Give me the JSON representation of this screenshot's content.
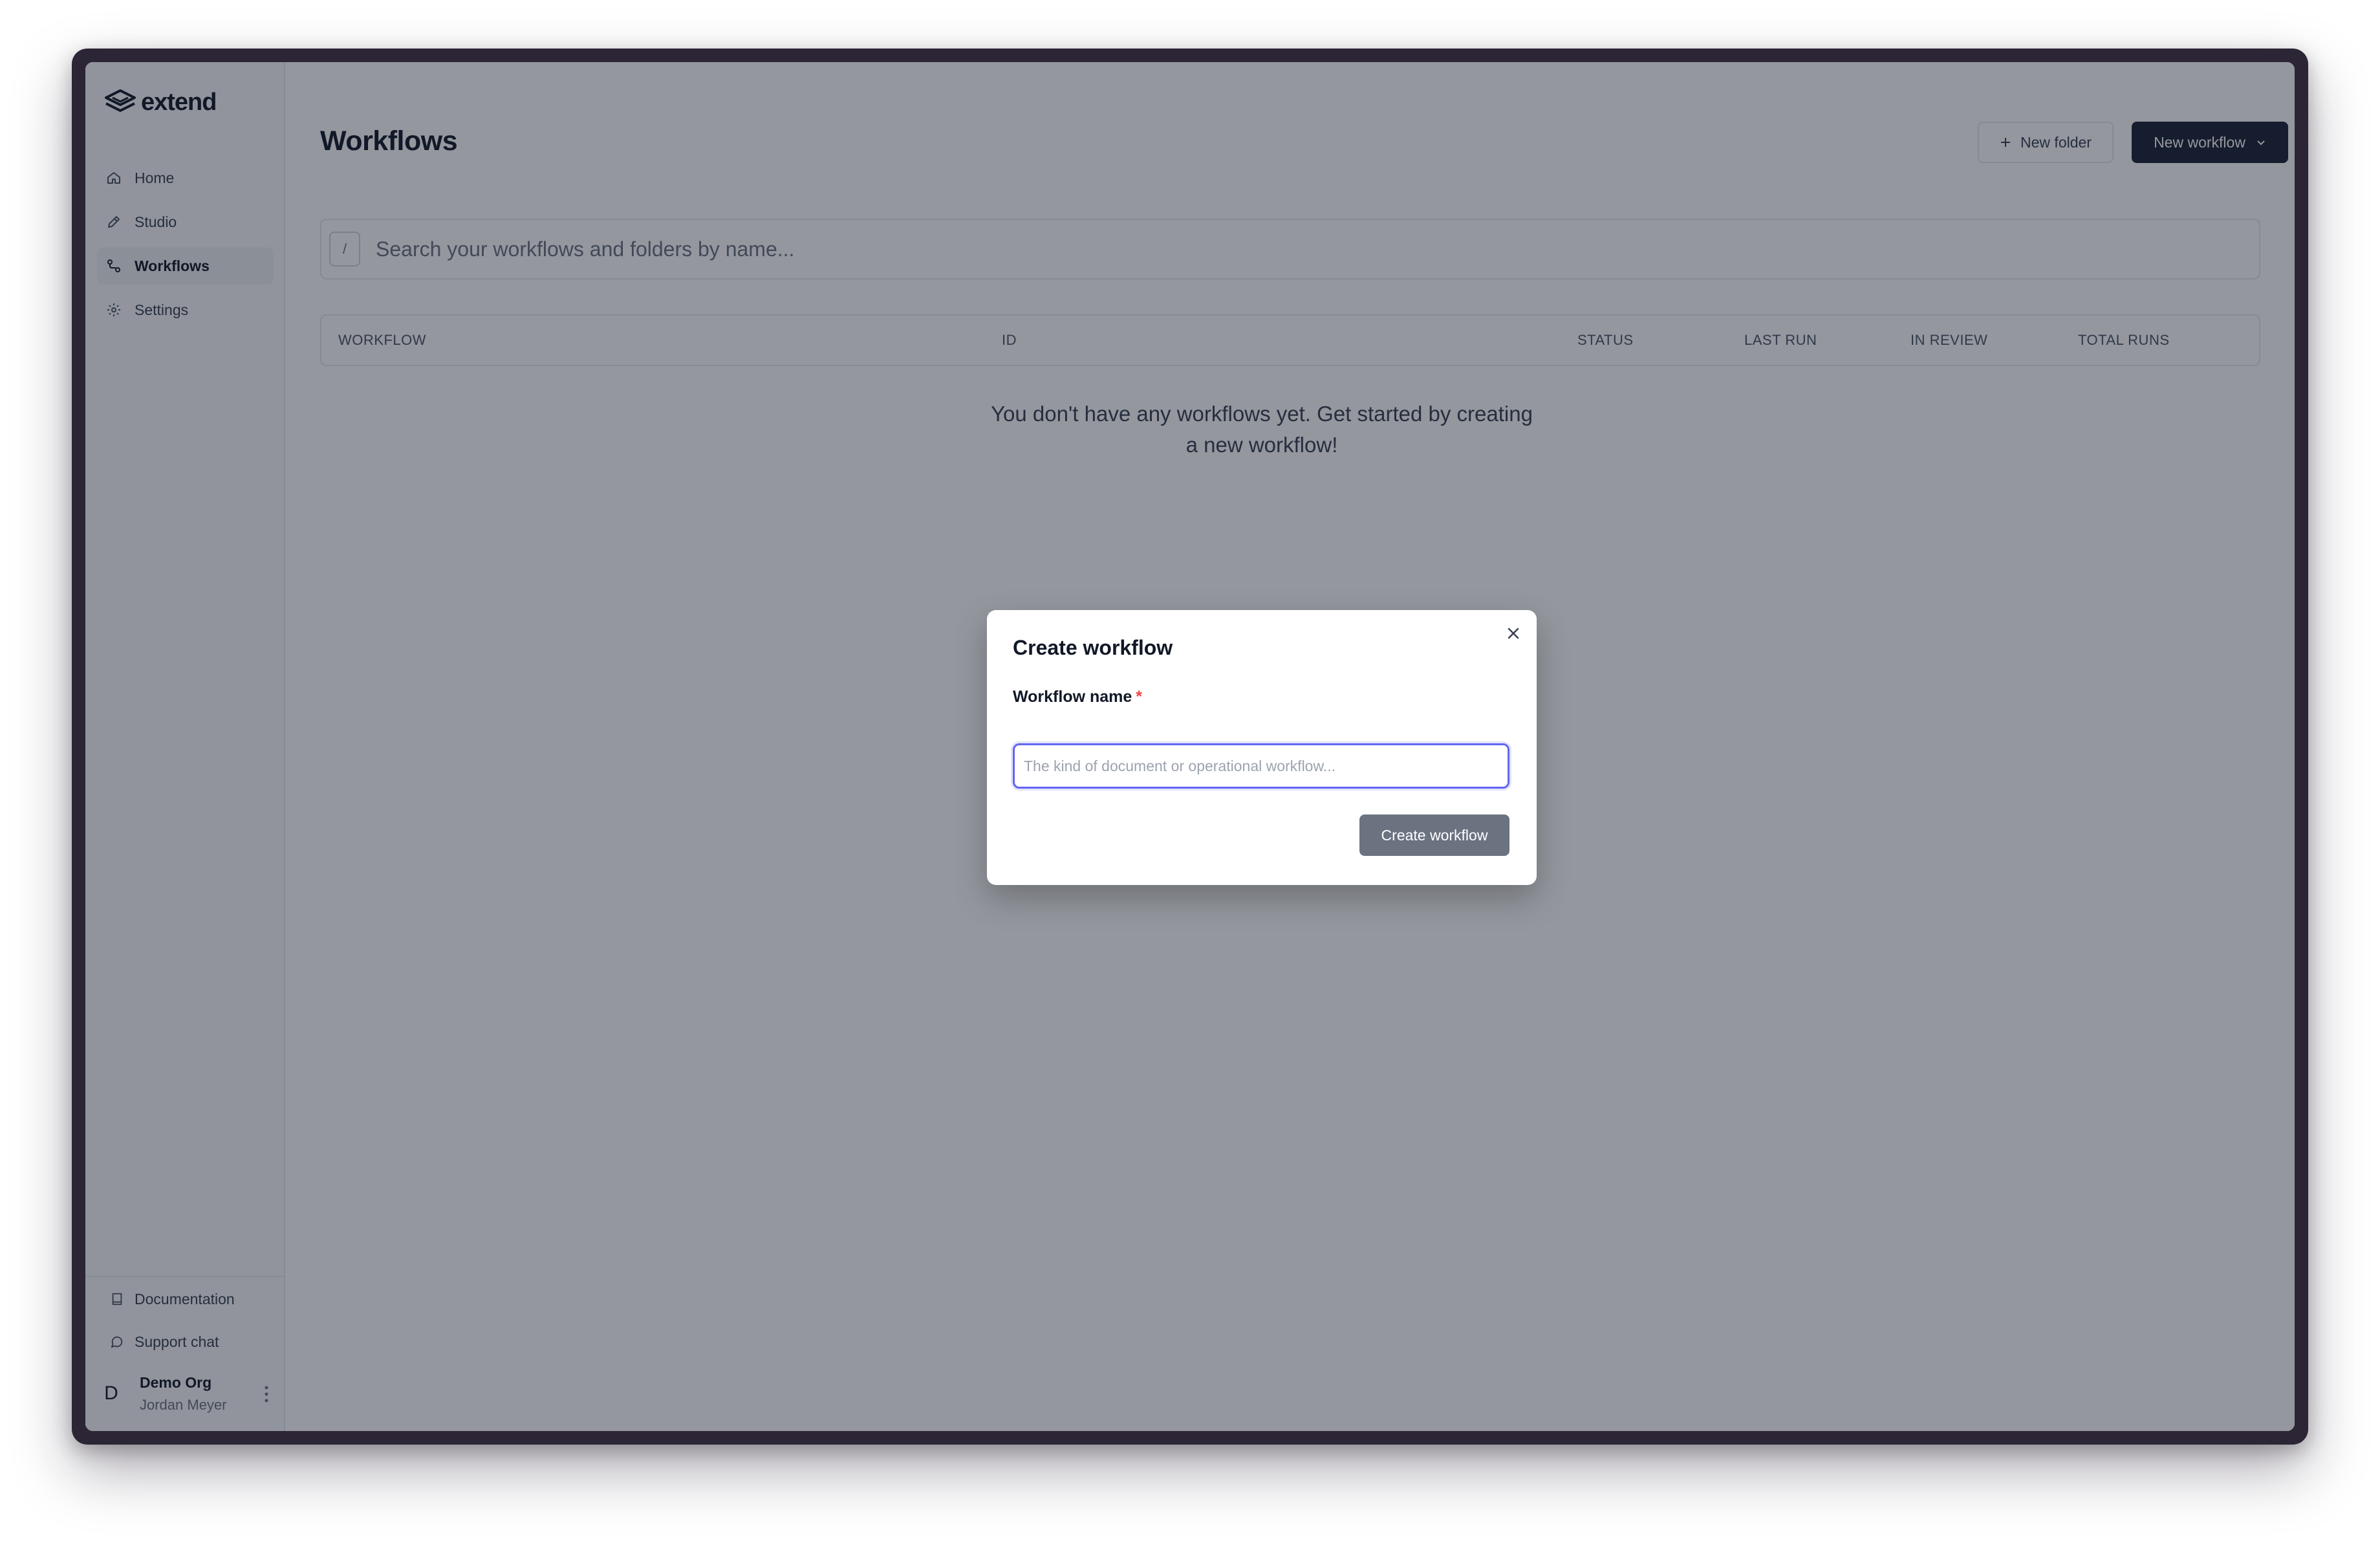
{
  "brand": {
    "name": "extend"
  },
  "sidebar": {
    "items": [
      {
        "label": "Home",
        "icon": "home-icon"
      },
      {
        "label": "Studio",
        "icon": "pencil-icon"
      },
      {
        "label": "Workflows",
        "icon": "workflow-icon",
        "active": true
      },
      {
        "label": "Settings",
        "icon": "gear-icon"
      }
    ],
    "documentation": "Documentation",
    "support_chat": "Support chat",
    "user": {
      "initial": "D",
      "org": "Demo Org",
      "name": "Jordan Meyer"
    }
  },
  "main": {
    "title": "Workflows",
    "new_folder_label": "New folder",
    "new_workflow_label": "New workflow",
    "search": {
      "slash": "/",
      "placeholder": "Search your workflows and folders by name..."
    },
    "table": {
      "columns": [
        "WORKFLOW",
        "ID",
        "STATUS",
        "LAST RUN",
        "IN REVIEW",
        "TOTAL RUNS"
      ]
    },
    "empty_line1": "You don't have any workflows yet. Get started by creating",
    "empty_line2": "a new workflow!"
  },
  "modal": {
    "title": "Create workflow",
    "field_label": "Workflow name",
    "required_mark": "*",
    "field_placeholder": "The kind of document or operational workflow...",
    "field_value": "",
    "submit_label": "Create workflow"
  },
  "colors": {
    "primary_button": "#1a2233",
    "focus_ring": "#6366f1",
    "required": "#ef4444",
    "disabled_button": "#6b7280"
  }
}
